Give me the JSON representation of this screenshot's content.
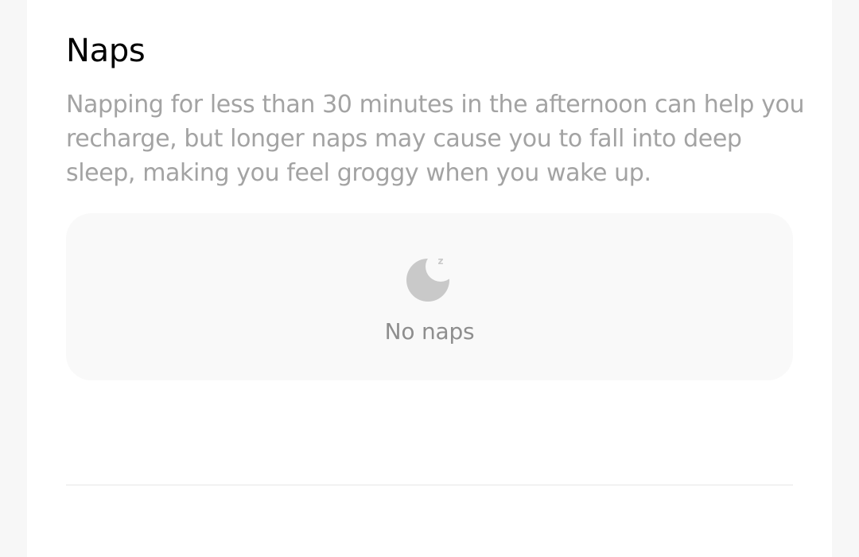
{
  "naps": {
    "title": "Naps",
    "description": "Napping for less than 30 minutes in the afternoon can help you recharge, but longer naps may cause you to fall into deep sleep, making you feel groggy when you wake up.",
    "empty_state": {
      "icon": "moon-sleep-icon",
      "label": "No naps"
    }
  },
  "colors": {
    "title": "#000000",
    "description": "#a3a3a3",
    "empty_bg": "#f9f9f9",
    "icon": "#c9c9c9",
    "empty_label": "#8e8e8e",
    "page_bg": "#f7f7f7",
    "card_bg": "#ffffff"
  }
}
